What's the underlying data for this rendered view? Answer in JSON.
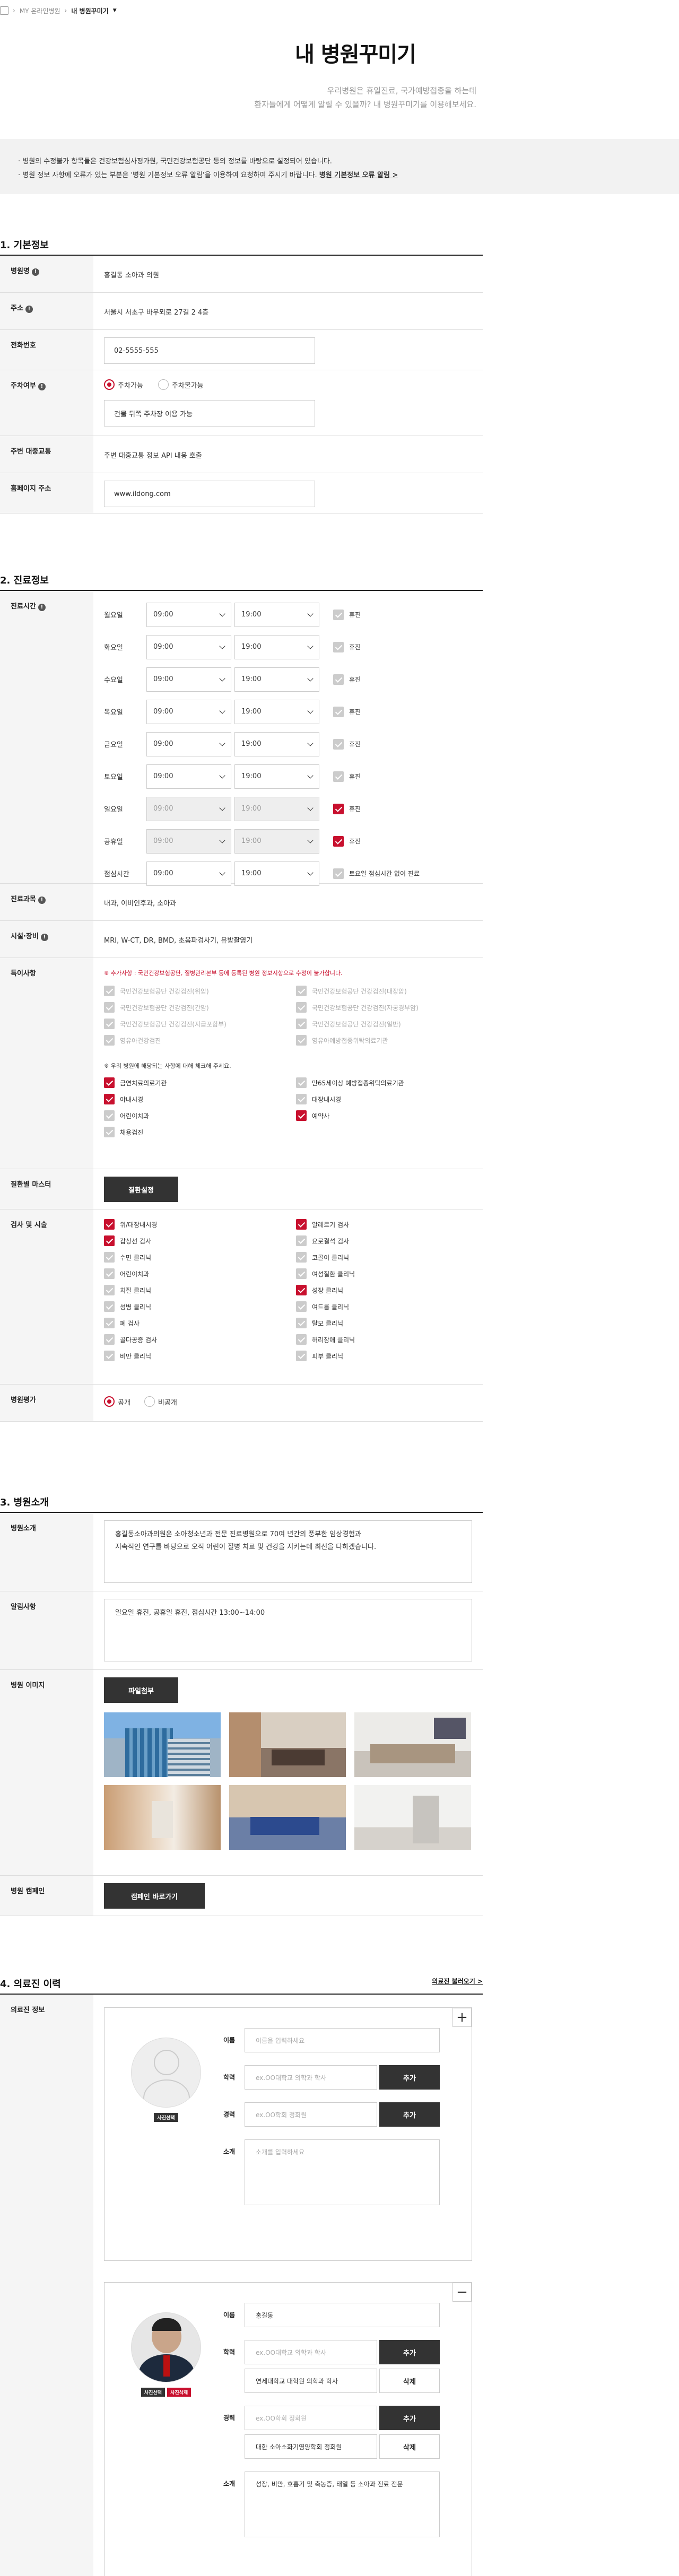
{
  "breadcrumb": {
    "home": "",
    "level1": "MY 온라인병원",
    "level2": "내 병원꾸미기"
  },
  "page": {
    "title": "내 병원꾸미기",
    "subtitle1": "우리병원은 휴일진료, 국가예방접종을 하는데",
    "subtitle2": "환자들에게 어떻게 알릴 수 있을까? 내 병원꾸미기를 이용해보세요."
  },
  "notice": {
    "line1": "· 병원의 수정불가 항목들은 건강보험심사평가원, 국민건강보험공단 등의 정보를 바탕으로 설정되어 있습니다.",
    "line2": "· 병원 정보 사항에 오류가 있는 부분은 '병원 기본정보 오류 알림'을 이용하여 요청하여 주시기 바랍니다.",
    "link": "병원 기본정보 오류 알림 >"
  },
  "basic": {
    "title": "1. 기본정보",
    "name_label": "병원명",
    "name": "홍길동 소아과 의원",
    "addr_label": "주소",
    "addr": "서울시 서초구 바우뫼로 27길 2 4층",
    "phone_label": "전화번호",
    "phone": "02-5555-555",
    "parking_label": "주차여부",
    "park_yes": "주차가능",
    "park_no": "주차불가능",
    "park_note": "건물 뒤쪽 주차장 이용 가능",
    "transit_label": "주변 대중교통",
    "transit": "주변 대중교통 정보 API 내용 호출",
    "web_label": "홈페이지 주소",
    "web": "www.ildong.com"
  },
  "clinic": {
    "title": "2. 진료정보",
    "hours_label": "진료시간",
    "closed": "휴진",
    "days": [
      {
        "day": "월요일",
        "start": "09:00",
        "end": "19:00",
        "closed": false,
        "disabled": false
      },
      {
        "day": "화요일",
        "start": "09:00",
        "end": "19:00",
        "closed": false,
        "disabled": false
      },
      {
        "day": "수요일",
        "start": "09:00",
        "end": "19:00",
        "closed": false,
        "disabled": false
      },
      {
        "day": "목요일",
        "start": "09:00",
        "end": "19:00",
        "closed": false,
        "disabled": false
      },
      {
        "day": "금요일",
        "start": "09:00",
        "end": "19:00",
        "closed": false,
        "disabled": false
      },
      {
        "day": "토요일",
        "start": "09:00",
        "end": "19:00",
        "closed": false,
        "disabled": false
      },
      {
        "day": "일요일",
        "start": "09:00",
        "end": "19:00",
        "closed": true,
        "disabled": true
      },
      {
        "day": "공휴일",
        "start": "09:00",
        "end": "19:00",
        "closed": true,
        "disabled": true
      }
    ],
    "lunch_label": "점심시간",
    "lunch_start": "09:00",
    "lunch_end": "19:00",
    "lunch_note": "토요일 점심시간 없이 진료",
    "subj_label": "진료과목",
    "subj": "내과, 이비인후과, 소아과",
    "equip_label": "시설·장비",
    "equip": "MRI, W-CT, DR, BMD, 초음파검사기, 유방촬영기",
    "feat_label": "특이사항",
    "feat_warn": "※ 추가사항 : 국민건강보험공단, 질병관리본부 등에 등록된 병원 정보시항으로 수정이 불가합니다.",
    "feat_fixed": [
      "국민건강보험공단 건강검진(위암)",
      "국민건강보험공단 건강검진(대장암)",
      "국민건강보험공단 건강검진(간암)",
      "국민건강보험공단 건강검진(자궁경부암)",
      "국민건강보험공단 건강검진(지급포함부)",
      "국민건강보험공단 건강검진(일반)",
      "영유아건강검진",
      "영유아예방접종위탁의료기관"
    ],
    "feat_note": "※ 우리 병원에 해당되는 사항에 대해 체크해 주세요.",
    "feat_items": [
      {
        "t": "금연치료의료기관",
        "on": true
      },
      {
        "t": "만65세이상 예방접종위탁의료기관",
        "on": false
      },
      {
        "t": "야내시경",
        "on": true
      },
      {
        "t": "대장내시경",
        "on": false
      },
      {
        "t": "어린이치과",
        "on": false
      },
      {
        "t": "예약사",
        "on": true
      },
      {
        "t": "채용검진",
        "on": false
      }
    ],
    "disease_label": "질환별 마스터",
    "disease_btn": "질환설정",
    "exam_label": "검사 및 시술",
    "exams": [
      {
        "t": "위/대장내시경",
        "on": true
      },
      {
        "t": "알레르기 검사",
        "on": true
      },
      {
        "t": "갑상선 검사",
        "on": true
      },
      {
        "t": "요로결석 검사",
        "on": false
      },
      {
        "t": "수면 클리닉",
        "on": false
      },
      {
        "t": "코골이 클리닉",
        "on": false
      },
      {
        "t": "어린이치과",
        "on": false
      },
      {
        "t": "여성질환 클리닉",
        "on": false
      },
      {
        "t": "치질 클리닉",
        "on": false
      },
      {
        "t": "성장 클리닉",
        "on": true
      },
      {
        "t": "성병 클리닉",
        "on": false
      },
      {
        "t": "여드름 클리닉",
        "on": false
      },
      {
        "t": "폐 검사",
        "on": false
      },
      {
        "t": "탈모 클리닉",
        "on": false
      },
      {
        "t": "골다공증 검사",
        "on": false
      },
      {
        "t": "허리장애 클리닉",
        "on": false
      },
      {
        "t": "비만 클리닉",
        "on": false
      },
      {
        "t": "피부 클리닉",
        "on": false
      }
    ],
    "eval_label": "병원평가",
    "eval_pub": "공개",
    "eval_priv": "비공개"
  },
  "intro": {
    "title": "3. 병원소개",
    "intro_label": "병원소개",
    "intro_text1": "홍길동소아과의원은 소아청소년과 전문 진료병원으로 70여 년간의 풍부한 임상경험과",
    "intro_text2": "지속적인 연구를 바탕으로 오직 어린이 질병 치료 및 건강을 지키는데 최선을 다하겠습니다.",
    "notice_label": "알림사항",
    "notice_text": "일요일 휴진, 공휴일 휴진, 점심시간 13:00~14:00",
    "image_label": "병원 이미지",
    "image_btn": "파일첨부",
    "campaign_label": "병원 캠페인",
    "campaign_btn": "캠페인 바로가기"
  },
  "staff": {
    "title": "4. 의료진 이력",
    "load_link": "의료진 불러오기 >",
    "info_label": "의료진 정보",
    "name_l": "이름",
    "edu_l": "학력",
    "career_l": "경력",
    "intro_l": "소개",
    "add": "추가",
    "del": "삭제",
    "ph_name": "이름을 입력하세요",
    "ph_edu": "ex.OO대학교 의학과 학사",
    "ph_career": "ex.OO학회 정회원",
    "ph_intro": "소개를 입력하세요",
    "photo_select": "사진선택",
    "photo_delete": "사진삭제",
    "doc_name": "홍길동",
    "doc_edu": "연세대학교 대학원 의학과 학사",
    "doc_career": "대한 소아소화기영양학회 정회원",
    "doc_intro": "성장, 비만, 호흡기 및 축농증, 태열 등 소아과 진료 전문"
  }
}
